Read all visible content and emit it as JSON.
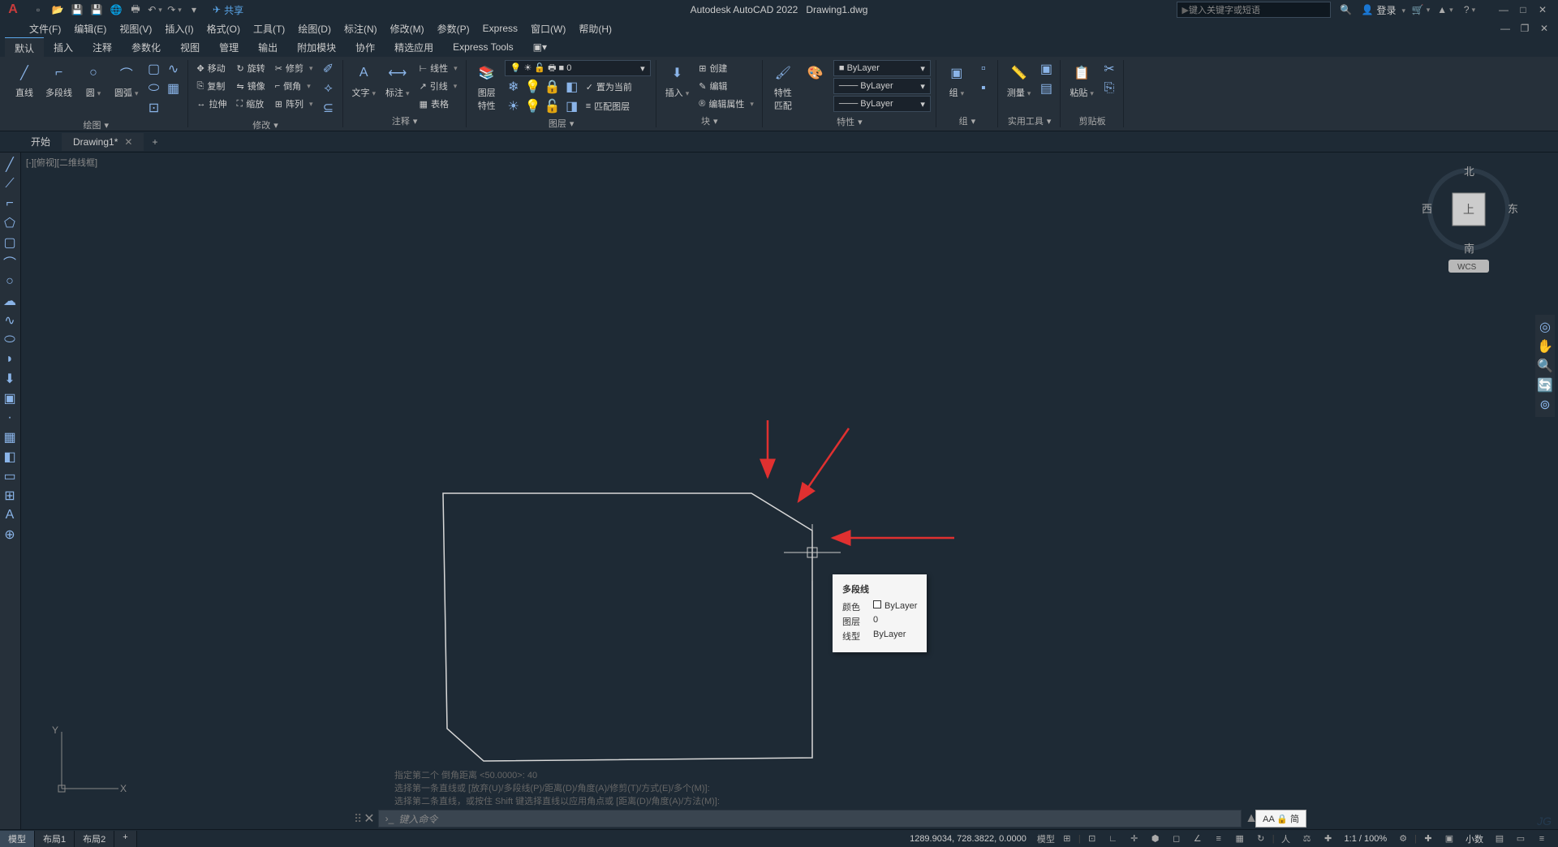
{
  "title_bar": {
    "app_name": "Autodesk AutoCAD 2022",
    "doc_name": "Drawing1.dwg",
    "share": "共享",
    "search_placeholder": "键入关键字或短语",
    "login": "登录"
  },
  "menu": [
    "文件(F)",
    "编辑(E)",
    "视图(V)",
    "插入(I)",
    "格式(O)",
    "工具(T)",
    "绘图(D)",
    "标注(N)",
    "修改(M)",
    "参数(P)",
    "Express",
    "窗口(W)",
    "帮助(H)"
  ],
  "ribbon_tabs": [
    "默认",
    "插入",
    "注释",
    "参数化",
    "视图",
    "管理",
    "输出",
    "附加模块",
    "协作",
    "精选应用",
    "Express Tools"
  ],
  "ribbon": {
    "draw": {
      "title": "绘图",
      "line": "直线",
      "pline": "多段线",
      "circle": "圆",
      "arc": "圆弧"
    },
    "modify": {
      "title": "修改",
      "move": "移动",
      "rotate": "旋转",
      "trim": "修剪",
      "copy": "复制",
      "mirror": "镜像",
      "fillet": "倒角",
      "stretch": "拉伸",
      "scale": "缩放",
      "array": "阵列"
    },
    "annotation": {
      "title": "注释",
      "text": "文字",
      "dim": "标注",
      "linear": "线性",
      "leader": "引线",
      "table": "表格"
    },
    "layers": {
      "title": "图层",
      "props": "图层\n特性",
      "current": "0",
      "make_current": "置为当前",
      "match": "匹配图层"
    },
    "block": {
      "title": "块",
      "insert": "插入",
      "create": "创建",
      "edit": "编辑",
      "attr": "编辑属性"
    },
    "properties": {
      "title": "特性",
      "match": "特性\n匹配",
      "layer_val": "ByLayer",
      "lw_val": "ByLayer",
      "lt_val": "ByLayer"
    },
    "groups": {
      "title": "组",
      "group": "组"
    },
    "utilities": {
      "title": "实用工具",
      "measure": "测量"
    },
    "clipboard": {
      "title": "剪贴板",
      "paste": "粘贴"
    }
  },
  "file_tabs": {
    "start": "开始",
    "drawing": "Drawing1*"
  },
  "viewport": {
    "label": "[-][俯视][二维线框]"
  },
  "viewcube": {
    "top": "北",
    "right": "东",
    "bottom": "南",
    "left": "西",
    "face": "上",
    "wcs": "WCS"
  },
  "tooltip": {
    "title": "多段线",
    "color_label": "颜色",
    "color_value": "ByLayer",
    "layer_label": "图层",
    "layer_value": "0",
    "linetype_label": "线型",
    "linetype_value": "ByLayer"
  },
  "command": {
    "hist1": "指定第二个 倒角距离 <50.0000>: 40",
    "hist2": "选择第一条直线或 [放弃(U)/多段线(P)/距离(D)/角度(A)/修剪(T)/方式(E)/多个(M)]:",
    "hist3": "选择第二条直线，或按住 Shift 键选择直线以应用角点或 [距离(D)/角度(A)/方法(M)]:",
    "prompt": "键入命令"
  },
  "ime": "AA 🔒 简",
  "status": {
    "model": "模型",
    "layout1": "布局1",
    "layout2": "布局2",
    "coords": "1289.9034, 728.3822, 0.0000",
    "model_btn": "模型",
    "scale": "1:1 / 100%",
    "decimal": "小数"
  },
  "ucs": {
    "x": "X",
    "y": "Y"
  }
}
